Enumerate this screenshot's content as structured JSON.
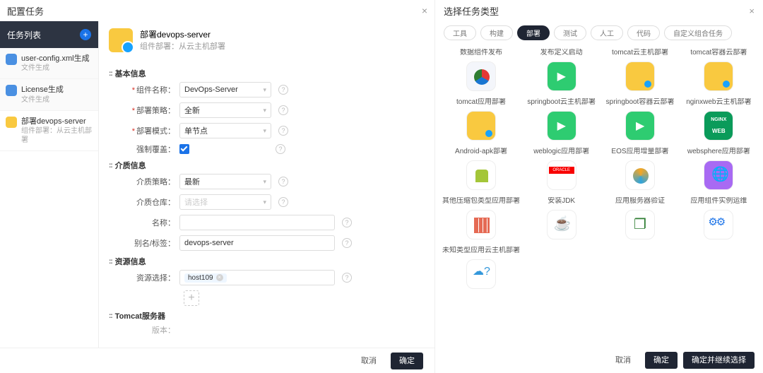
{
  "left": {
    "title": "配置任务",
    "sidebar_header": "任务列表",
    "sidebar_items": [
      {
        "title": "user-config.xml生成",
        "sub": "文件生成"
      },
      {
        "title": "License生成",
        "sub": "文件生成"
      },
      {
        "title": "部署devops-server",
        "sub": "组件部署：从云主机部署"
      }
    ],
    "task_header": {
      "title": "部署devops-server",
      "sub": "组件部署：从云主机部署"
    },
    "sections": {
      "basic": "基本信息",
      "media": "介质信息",
      "resource": "资源信息",
      "tomcat": "Tomcat服务器"
    },
    "fields": {
      "component_label": "组件名称：",
      "component_value": "DevOps-Server",
      "strategy_label": "部署策略：",
      "strategy_value": "全新",
      "mode_label": "部署模式：",
      "mode_value": "单节点",
      "force_label": "强制覆盖：",
      "media_strategy_label": "介质策略：",
      "media_strategy_value": "最新",
      "media_repo_label": "介质仓库：",
      "media_repo_placeholder": "请选择",
      "name_label": "名称：",
      "alias_label": "别名/标签：",
      "alias_value": "devops-server",
      "resource_label": "资源选择：",
      "resource_tag": "host109",
      "version_label": "版本："
    },
    "buttons": {
      "cancel": "取消",
      "ok": "确定"
    }
  },
  "right": {
    "title": "选择任务类型",
    "tabs": [
      {
        "label": "工具",
        "active": false
      },
      {
        "label": "构建",
        "active": false
      },
      {
        "label": "部署",
        "active": true
      },
      {
        "label": "测试",
        "active": false
      },
      {
        "label": "人工",
        "active": false
      },
      {
        "label": "代码",
        "active": false
      },
      {
        "label": "自定义组合任务",
        "active": false
      }
    ],
    "cards": [
      {
        "label": "数据组件发布",
        "icon": "pie"
      },
      {
        "label": "发布定义启动",
        "icon": "green"
      },
      {
        "label": "tomcat云主机部署",
        "icon": "tom"
      },
      {
        "label": "tomcat容器云部署",
        "icon": "tom"
      },
      {
        "label": "tomcat应用部署",
        "icon": "tom"
      },
      {
        "label": "springboot云主机部署",
        "icon": "green"
      },
      {
        "label": "springboot容器云部署",
        "icon": "green"
      },
      {
        "label": "nginxweb云主机部署",
        "icon": "nginx"
      },
      {
        "label": "Android-apk部署",
        "icon": "andr"
      },
      {
        "label": "weblogic应用部署",
        "icon": "oracle"
      },
      {
        "label": "EOS应用增量部署",
        "icon": "swirl"
      },
      {
        "label": "websphere应用部署",
        "icon": "globe"
      },
      {
        "label": "其他压缩包类型应用部署",
        "icon": "pack"
      },
      {
        "label": "安装JDK",
        "icon": "java"
      },
      {
        "label": "应用服务器验证",
        "icon": "cube"
      },
      {
        "label": "应用组件实例运维",
        "icon": "gears"
      },
      {
        "label": "未知类型应用云主机部署",
        "icon": "cloud"
      }
    ],
    "buttons": {
      "cancel": "取消",
      "ok": "确定",
      "ok_continue": "确定并继续选择"
    }
  }
}
